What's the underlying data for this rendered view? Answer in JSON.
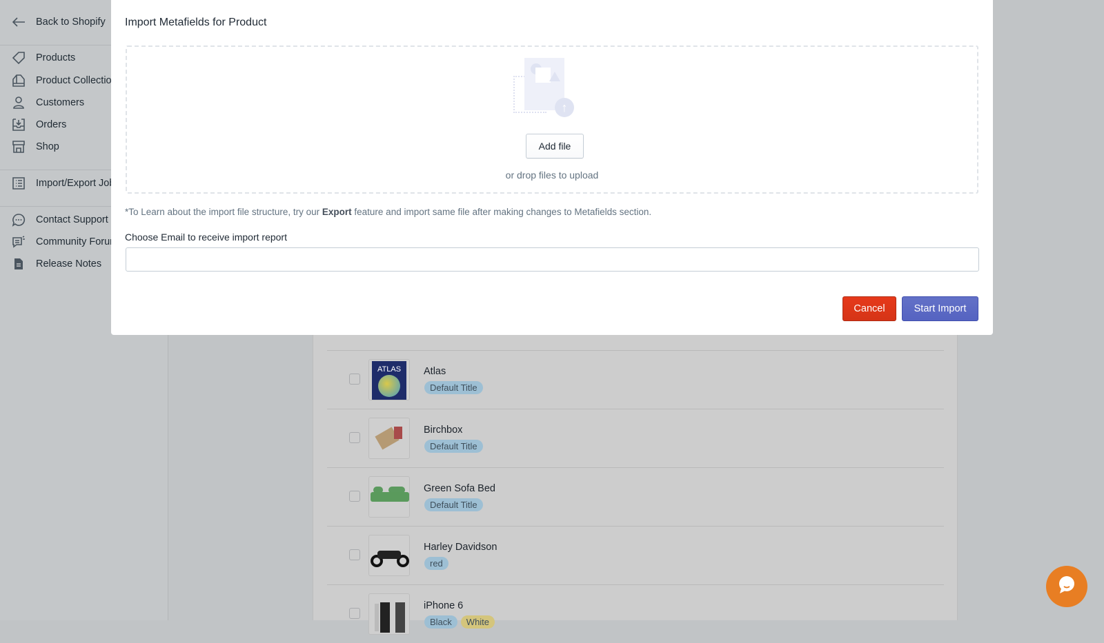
{
  "sidebar": {
    "back": "Back to Shopify",
    "items": [
      {
        "label": "Products",
        "icon": "tag-icon"
      },
      {
        "label": "Product Collections",
        "icon": "collection-icon"
      },
      {
        "label": "Customers",
        "icon": "person-icon"
      },
      {
        "label": "Orders",
        "icon": "inbox-download-icon"
      },
      {
        "label": "Shop",
        "icon": "store-icon"
      },
      {
        "label": "Import/Export Jobs",
        "icon": "list-icon"
      },
      {
        "label": "Contact Support",
        "icon": "chat-icon"
      },
      {
        "label": "Community Forum",
        "icon": "forum-icon"
      },
      {
        "label": "Release Notes",
        "icon": "document-icon"
      }
    ]
  },
  "products": [
    {
      "name": "Atlas",
      "variants": [
        "Default Title"
      ]
    },
    {
      "name": "Birchbox",
      "variants": [
        "Default Title"
      ]
    },
    {
      "name": "Green Sofa Bed",
      "variants": [
        "Default Title"
      ]
    },
    {
      "name": "Harley Davidson",
      "variants": [
        "red"
      ]
    },
    {
      "name": "iPhone 6",
      "variants": [
        "Black",
        "White"
      ]
    }
  ],
  "modal": {
    "title": "Import Metafields for Product",
    "add_file": "Add file",
    "drop_text": "or drop files to upload",
    "note_pre": "*To Learn about the import file structure, try our ",
    "note_bold": "Export",
    "note_post": " feature and import same file after making changes to Metafields section.",
    "email_label": "Choose Email to receive import report",
    "email_value": "",
    "cancel": "Cancel",
    "start": "Start Import"
  },
  "colors": {
    "cancel": "#de3618",
    "primary": "#5c6ac4",
    "chat": "#e87e23"
  }
}
